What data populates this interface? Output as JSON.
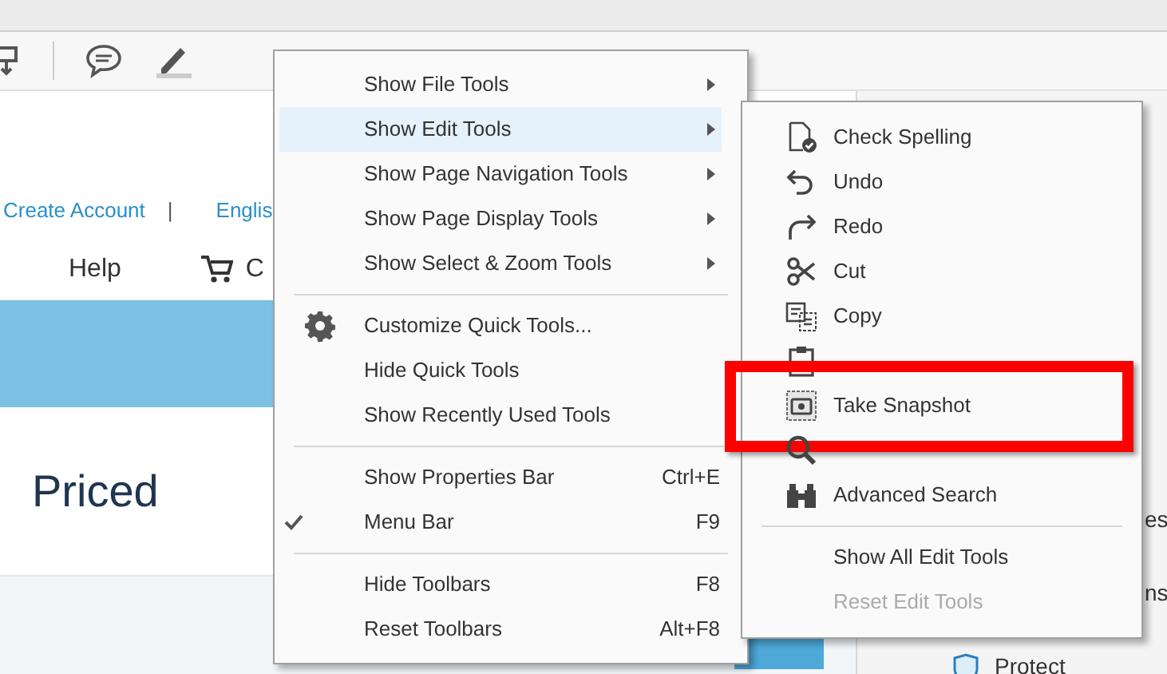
{
  "web_page": {
    "links": [
      {
        "label": "Create Account"
      },
      {
        "label": "|"
      },
      {
        "label": "Englis"
      }
    ],
    "nav": [
      "Help",
      "C"
    ],
    "heading": "Priced"
  },
  "right_panel": {
    "texts": [
      "es",
      "ns"
    ],
    "protect": "Protect"
  },
  "context_menu": {
    "groups": [
      [
        {
          "label": "Show File Tools",
          "submenu": true,
          "selected": false,
          "checked": false
        },
        {
          "label": "Show Edit Tools",
          "submenu": true,
          "selected": true,
          "checked": false
        },
        {
          "label": "Show Page Navigation Tools",
          "submenu": true,
          "selected": false,
          "checked": false
        },
        {
          "label": "Show Page Display Tools",
          "submenu": true,
          "selected": false,
          "checked": false
        },
        {
          "label": "Show Select & Zoom Tools",
          "submenu": true,
          "selected": false,
          "checked": false
        }
      ],
      [
        {
          "label": "Customize Quick Tools...",
          "submenu": false,
          "selected": false,
          "checked": false,
          "kind": "gear"
        },
        {
          "label": "Hide Quick Tools",
          "submenu": false,
          "selected": false,
          "checked": false
        },
        {
          "label": "Show Recently Used Tools",
          "submenu": false,
          "selected": false,
          "checked": false
        }
      ],
      [
        {
          "label": "Show Properties Bar",
          "shortcut": "Ctrl+E",
          "submenu": false,
          "selected": false,
          "checked": false
        },
        {
          "label": "Menu Bar",
          "shortcut": "F9",
          "submenu": false,
          "selected": false,
          "checked": true
        }
      ],
      [
        {
          "label": "Hide Toolbars",
          "shortcut": "F8",
          "submenu": false,
          "selected": false,
          "checked": false
        },
        {
          "label": "Reset Toolbars",
          "shortcut": "Alt+F8",
          "submenu": false,
          "selected": false,
          "checked": false
        }
      ]
    ]
  },
  "edit_tools_menu": {
    "tools": [
      {
        "label": "Check Spelling",
        "annotated": false
      },
      {
        "label": "Undo",
        "annotated": false
      },
      {
        "label": "Redo",
        "annotated": false
      },
      {
        "label": "Cut",
        "annotated": false
      },
      {
        "label": "Copy",
        "annotated": false
      },
      {
        "annotated": false
      },
      {
        "label": "Take Snapshot",
        "annotated": true
      },
      {
        "annotated": false
      },
      {
        "label": "Advanced Search",
        "annotated": false
      }
    ],
    "commands": [
      {
        "label": "Show All Edit Tools",
        "disabled": false
      },
      {
        "label": "Reset Edit Tools",
        "disabled": true
      }
    ]
  }
}
